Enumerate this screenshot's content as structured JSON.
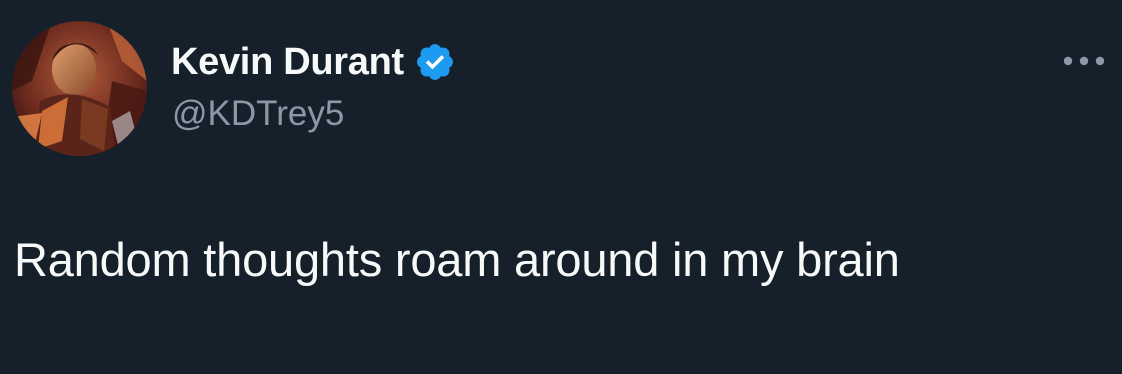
{
  "tweet": {
    "author": {
      "display_name": "Kevin Durant",
      "handle": "@KDTrey5",
      "verified": true,
      "avatar_icon": "profile-photo"
    },
    "text": "Random thoughts roam around in my brain",
    "more_icon": "more-horizontal-icon"
  },
  "colors": {
    "background": "#15202b",
    "primary_text": "#f7f9f9",
    "secondary_text": "#8b98a5",
    "verified_badge": "#1d9bf0"
  }
}
